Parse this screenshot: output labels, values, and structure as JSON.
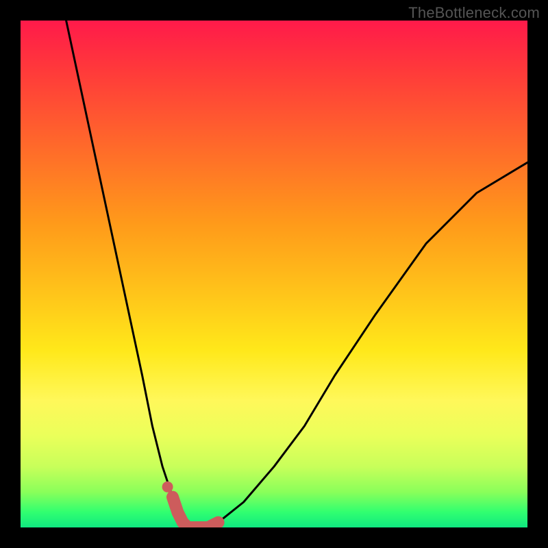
{
  "watermark": "TheBottleneck.com",
  "chart_data": {
    "type": "line",
    "title": "",
    "xlabel": "",
    "ylabel": "",
    "xlim": [
      0,
      100
    ],
    "ylim": [
      0,
      100
    ],
    "grid": false,
    "series": [
      {
        "name": "bottleneck-curve",
        "color": "#000000",
        "x": [
          9,
          12,
          15,
          18,
          21,
          24,
          26,
          28,
          30,
          31,
          32,
          33,
          35,
          37,
          39,
          44,
          50,
          56,
          62,
          70,
          80,
          90,
          100
        ],
        "values": [
          100,
          86,
          72,
          58,
          44,
          30,
          20,
          12,
          6,
          3,
          1,
          0,
          0,
          0,
          1,
          5,
          12,
          20,
          30,
          42,
          56,
          66,
          72
        ]
      },
      {
        "name": "highlight-segment",
        "color": "#cd5c5c",
        "x": [
          30,
          31,
          32,
          33,
          35,
          37,
          39
        ],
        "values": [
          6,
          3,
          1,
          0,
          0,
          0,
          1
        ]
      }
    ],
    "markers": [
      {
        "name": "highlight-dot",
        "x": 29,
        "y": 8,
        "color": "#cd5c5c"
      }
    ],
    "background": {
      "type": "vertical-gradient",
      "stops": [
        {
          "pos": 0,
          "color": "#ff1a4a"
        },
        {
          "pos": 25,
          "color": "#ff6a2a"
        },
        {
          "pos": 55,
          "color": "#ffc81a"
        },
        {
          "pos": 75,
          "color": "#fff85a"
        },
        {
          "pos": 93,
          "color": "#8aff5a"
        },
        {
          "pos": 100,
          "color": "#10e880"
        }
      ]
    }
  }
}
